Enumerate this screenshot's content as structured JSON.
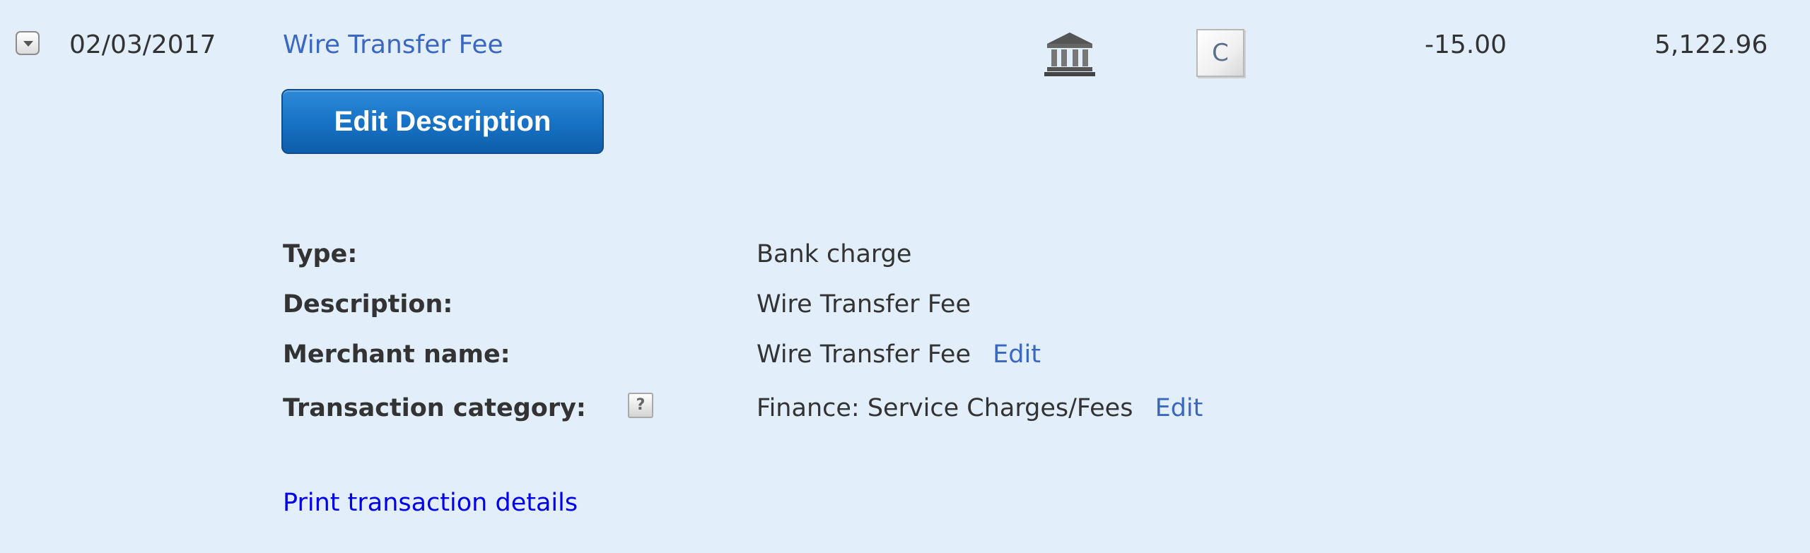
{
  "transaction": {
    "date": "02/03/2017",
    "description": "Wire Transfer Fee",
    "amount": "-15.00",
    "balance": "5,122.96",
    "status_code": "C",
    "source_icon": "bank-icon",
    "expand_icon": "chevron-down-icon"
  },
  "actions": {
    "edit_description_label": "Edit Description",
    "print_label": "Print transaction details"
  },
  "details": {
    "type_label": "Type:",
    "type_value": "Bank charge",
    "description_label": "Description:",
    "description_value": "Wire Transfer Fee",
    "merchant_label": "Merchant name:",
    "merchant_value": "Wire Transfer Fee",
    "merchant_edit": "Edit",
    "category_label": "Transaction category:",
    "category_help": "?",
    "category_value": "Finance: Service Charges/Fees",
    "category_edit": "Edit"
  },
  "colors": {
    "background": "#e2eef9",
    "link": "#3a67c1",
    "print_link": "#0000ee",
    "button": "#1873c6",
    "text": "#333333"
  }
}
